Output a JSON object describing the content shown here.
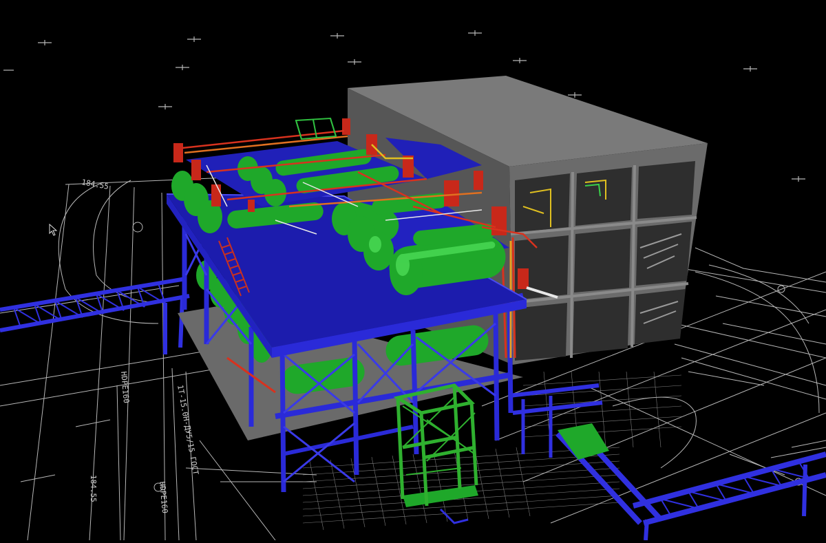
{
  "viewport": {
    "name": "3D plant model over site plan drawing",
    "background": "#000000"
  },
  "colors": {
    "structural_steel": "#2a2ad8",
    "deck": "#1f1fa8",
    "vessels": "#1fa82a",
    "vessel_highlight": "#52e35c",
    "piping_red": "#d8321e",
    "building": "#6a6a6a",
    "building_dark": "#3c3c3c",
    "drawing_lines": "#d9d9d9",
    "piping_yellow": "#e0c020"
  },
  "drawing_labels": {
    "elev_1": "184.55",
    "elev_2": "184.55",
    "hdpe_1": "HDPE160",
    "hdpe_2": "HDPE160",
    "note_1": "1Т-15.0H-ДУ5/15 ГОСТ"
  },
  "cursor": {
    "icon": "arrow-cursor-icon"
  }
}
